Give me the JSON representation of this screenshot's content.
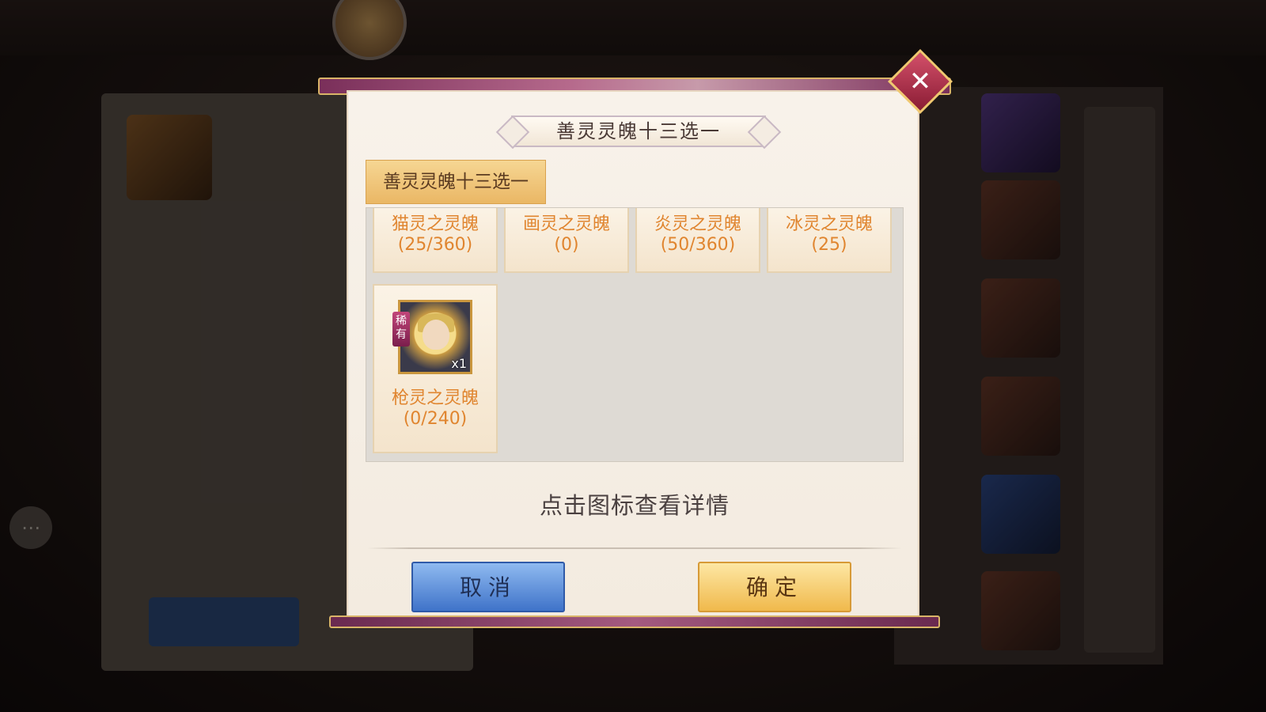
{
  "background": {
    "chat_icon": "chat-bubble-icon"
  },
  "dialog": {
    "title": "善灵灵魄十三选一",
    "close_icon": "close-icon",
    "tab_label": "善灵灵魄十三选一",
    "items": [
      {
        "name": "猫灵之灵魄",
        "count": "(25/360)"
      },
      {
        "name": "画灵之灵魄",
        "count": "(0)"
      },
      {
        "name": "炎灵之灵魄",
        "count": "(50/360)"
      },
      {
        "name": "冰灵之灵魄",
        "count": "(25)"
      },
      {
        "name": "枪灵之灵魄",
        "count": "(0/240)",
        "rarity": "稀有",
        "quantity": "x1"
      }
    ],
    "hint": "点击图标查看详情",
    "cancel_label": "取消",
    "confirm_label": "确定"
  }
}
